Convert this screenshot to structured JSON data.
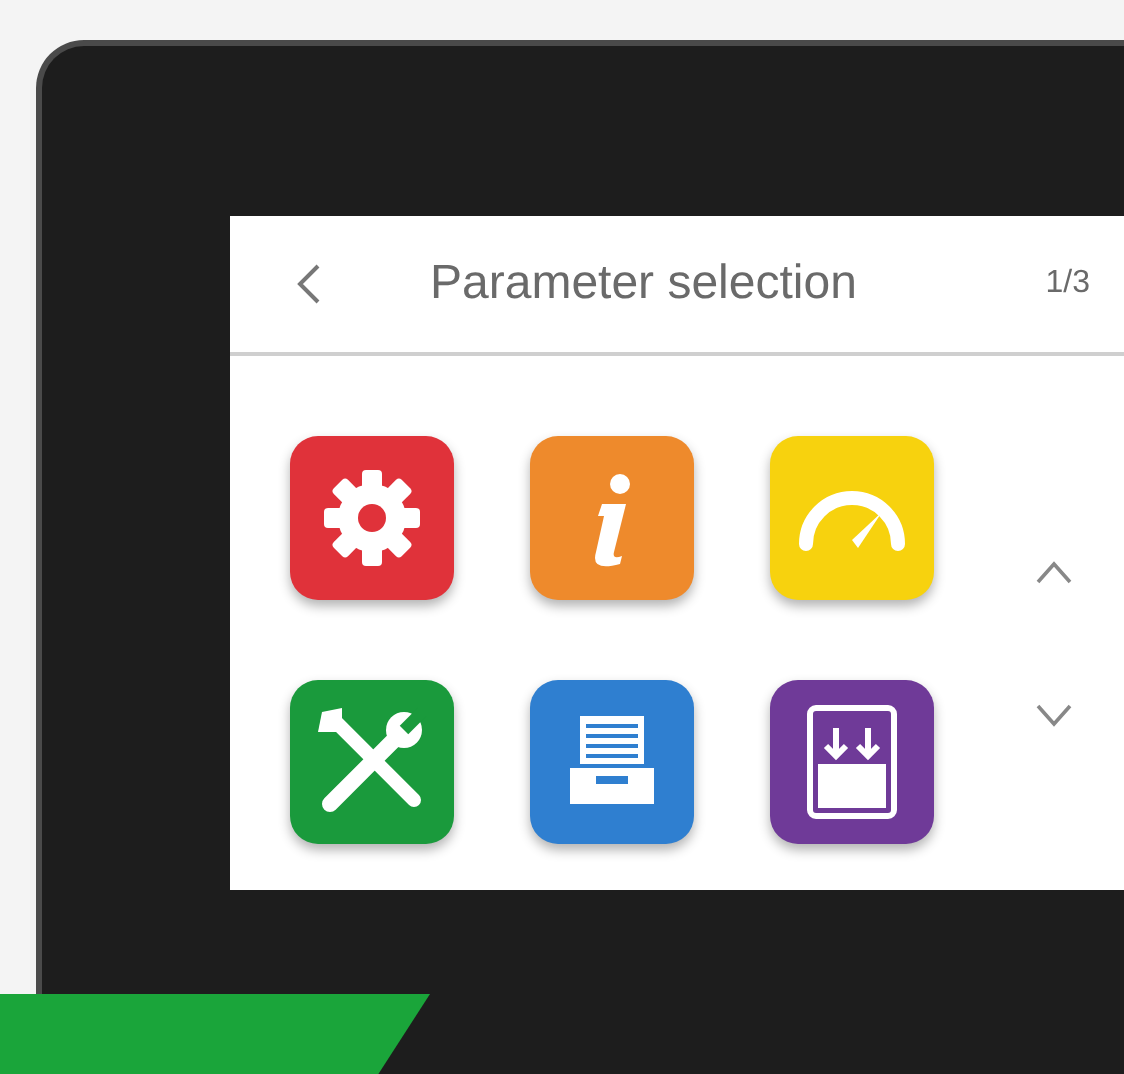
{
  "header": {
    "title": "Parameter selection",
    "page": "1/3"
  },
  "tiles": [
    {
      "kind": "gear",
      "color": "#e0323a"
    },
    {
      "kind": "info",
      "color": "#ee8a2c"
    },
    {
      "kind": "gauge",
      "color": "#f7d20e"
    },
    {
      "kind": "tools",
      "color": "#1a9a3c"
    },
    {
      "kind": "archive",
      "color": "#2f7fd0"
    },
    {
      "kind": "download",
      "color": "#6f3a98"
    }
  ]
}
